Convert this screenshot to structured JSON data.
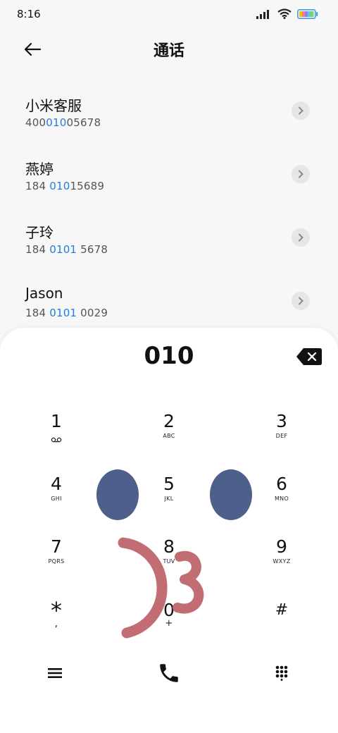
{
  "status": {
    "time": "8:16"
  },
  "header": {
    "title": "通话"
  },
  "contacts": [
    {
      "name": "小米客服",
      "number_pre": "400",
      "number_hl": "010",
      "number_post": "05678"
    },
    {
      "name": "燕婷",
      "number_pre": "184 ",
      "number_hl": "010",
      "number_post": "15689"
    },
    {
      "name": "子玲",
      "number_pre": "184 ",
      "number_hl": "0101",
      "number_post": " 5678"
    },
    {
      "name": "Jason",
      "number_pre": "184 ",
      "number_hl": "0101",
      "number_post": " 0029"
    }
  ],
  "dialer": {
    "display": "010",
    "keys": [
      {
        "digit": "1",
        "letters": ""
      },
      {
        "digit": "2",
        "letters": "ABC"
      },
      {
        "digit": "3",
        "letters": "DEF"
      },
      {
        "digit": "4",
        "letters": "GHI"
      },
      {
        "digit": "5",
        "letters": "JKL"
      },
      {
        "digit": "6",
        "letters": "MNO"
      },
      {
        "digit": "7",
        "letters": "PQRS"
      },
      {
        "digit": "8",
        "letters": "TUV"
      },
      {
        "digit": "9",
        "letters": "WXYZ"
      },
      {
        "digit": "*",
        "letters": ","
      },
      {
        "digit": "0",
        "letters": "+"
      },
      {
        "digit": "#",
        "letters": ""
      }
    ]
  },
  "colors": {
    "highlight": "#1f7fe0",
    "overlay_eyes": "#4d5f8a",
    "overlay_smile": "#c26d74"
  },
  "icons": {
    "back": "arrow-left-icon",
    "backspace": "backspace-icon",
    "menu": "menu-icon",
    "call": "phone-icon",
    "dialpad": "dialpad-icon",
    "voicemail": "voicemail-icon"
  }
}
